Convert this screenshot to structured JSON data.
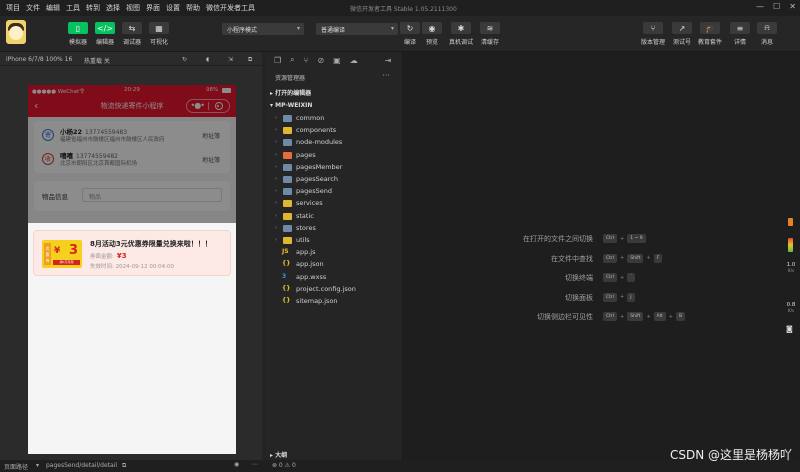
{
  "menu": [
    "项目",
    "文件",
    "编辑",
    "工具",
    "转到",
    "选择",
    "视图",
    "界面",
    "设置",
    "帮助",
    "微信开发者工具"
  ],
  "window_title": "微信开发者工具 Stable 1.05.2111300",
  "toolbar": {
    "simulator": "模拟器",
    "editor": "编辑器",
    "debugger": "调试器",
    "visual": "可视化",
    "mode": "小程序模式",
    "compile_mode": "普通编译",
    "compile": "编译",
    "preview": "预览",
    "real_debug": "真机调试",
    "clear_cache": "清缓存",
    "version": "版本管理",
    "test": "测试号",
    "edu": "教育套件",
    "details": "详情",
    "messages": "消息"
  },
  "simbar": {
    "device": "iPhone 6/7/8 100% 16",
    "hot_reload": "热重载 关"
  },
  "phone": {
    "carrier": "●●●●● WeChat令",
    "time": "20:29",
    "battery": "98%",
    "nav_title": "物流快递寄件小程序",
    "sender": {
      "badge": "寄",
      "name": "小杨22",
      "phone": "13774559483",
      "address": "福建省福州市鼓楼区福州市鼓楼区人民政府",
      "book": "地址簿"
    },
    "receiver": {
      "badge": "收",
      "name": "嘻嘻",
      "phone": "13774559482",
      "address": "北京市朝阳区北京首都国际机场",
      "book": "地址簿"
    },
    "goods_label": "物品信息",
    "goods_value": "物品",
    "coupon": {
      "side": "优惠券",
      "yen": "¥",
      "amount": "3",
      "tag": "满0元可用",
      "headline": "8月活动3元优惠券限量兑换来啦！！！",
      "value_label": "券面金额:",
      "value": "¥3",
      "expire": "失效时间:   2024-09-12 00:04:00"
    }
  },
  "explorer": {
    "title": "资源管理器",
    "open_editors": "打开的编辑器",
    "project": "MP-WEIXIN",
    "items": [
      {
        "name": "common",
        "kind": "folder",
        "color": "#6d8aa6"
      },
      {
        "name": "components",
        "kind": "folder",
        "color": "#e0b830"
      },
      {
        "name": "node-modules",
        "kind": "folder",
        "color": "#6d8aa6"
      },
      {
        "name": "pages",
        "kind": "folder",
        "color": "#e46d3b"
      },
      {
        "name": "pagesMember",
        "kind": "folder",
        "color": "#6d8aa6"
      },
      {
        "name": "pagesSearch",
        "kind": "folder",
        "color": "#6d8aa6"
      },
      {
        "name": "pagesSend",
        "kind": "folder",
        "color": "#6d8aa6"
      },
      {
        "name": "services",
        "kind": "folder",
        "color": "#e0b830"
      },
      {
        "name": "static",
        "kind": "folder",
        "color": "#e0b830"
      },
      {
        "name": "stores",
        "kind": "folder",
        "color": "#6d8aa6"
      },
      {
        "name": "utils",
        "kind": "folder",
        "color": "#e0b830"
      },
      {
        "name": "app.js",
        "kind": "file",
        "glyph": "JS",
        "color": "#e8c22e"
      },
      {
        "name": "app.json",
        "kind": "file",
        "glyph": "{}",
        "color": "#e8c22e"
      },
      {
        "name": "app.wxss",
        "kind": "file",
        "glyph": "3",
        "color": "#3c8fe0"
      },
      {
        "name": "project.config.json",
        "kind": "file",
        "glyph": "{}",
        "color": "#e8c22e"
      },
      {
        "name": "sitemap.json",
        "kind": "file",
        "glyph": "{}",
        "color": "#e8c22e"
      }
    ],
    "outline": "大纲"
  },
  "shortcuts": [
    {
      "label": "在打开的文件之间切换",
      "keys": [
        "Ctrl",
        "1 ~ 9"
      ]
    },
    {
      "label": "在文件中查找",
      "keys": [
        "Ctrl",
        "Shift",
        "F"
      ]
    },
    {
      "label": "切换终端",
      "keys": [
        "Ctrl",
        "`"
      ]
    },
    {
      "label": "切换面板",
      "keys": [
        "Ctrl",
        "J"
      ]
    },
    {
      "label": "切换侧边栏可见性",
      "keys": [
        "Ctrl",
        "Shift",
        "Alt",
        "B"
      ]
    }
  ],
  "right_stats": {
    "top": "1.0",
    "top_unit": "K/s",
    "bottom": "0.8",
    "bottom_unit": "K/s"
  },
  "status": {
    "path_label": "页面路径",
    "path": "pagesSend/detail/detail",
    "errors": "⊗ 0 ⚠ 0"
  },
  "watermark": "CSDN @这里是杨杨吖"
}
